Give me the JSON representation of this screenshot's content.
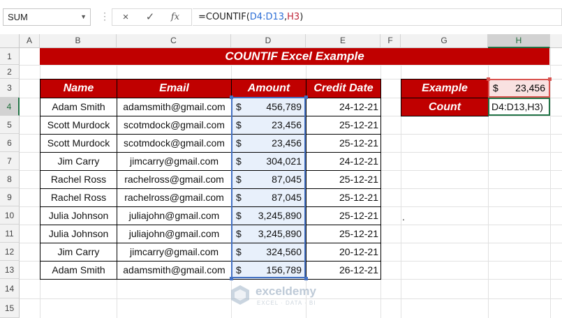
{
  "formula_bar": {
    "name_box": "SUM",
    "cancel_icon": "×",
    "enter_icon": "✓",
    "fx_icon": "fx",
    "formula_prefix": "=COUNTIF(",
    "formula_ref1": "D4:D13",
    "formula_comma": ",",
    "formula_ref2": "H3",
    "formula_suffix": ")"
  },
  "columns": [
    "A",
    "B",
    "C",
    "D",
    "E",
    "F",
    "G",
    "H"
  ],
  "rows": [
    "1",
    "2",
    "3",
    "4",
    "5",
    "6",
    "7",
    "8",
    "9",
    "10",
    "11",
    "12",
    "13",
    "14",
    "15"
  ],
  "title": "COUNTIF Excel Example",
  "table": {
    "headers": {
      "name": "Name",
      "email": "Email",
      "amount": "Amount",
      "date": "Credit Date"
    },
    "currency": "$",
    "rows": [
      {
        "name": "Adam Smith",
        "email": "adamsmith@gmail.com",
        "amount": "456,789",
        "date": "24-12-21"
      },
      {
        "name": "Scott Murdock",
        "email": "scotmdock@gmail.com",
        "amount": "23,456",
        "date": "25-12-21"
      },
      {
        "name": "Scott Murdock",
        "email": "scotmdock@gmail.com",
        "amount": "23,456",
        "date": "25-12-21"
      },
      {
        "name": "Jim Carry",
        "email": "jimcarry@gmail.com",
        "amount": "304,021",
        "date": "24-12-21"
      },
      {
        "name": "Rachel Ross",
        "email": "rachelross@gmail.com",
        "amount": "87,045",
        "date": "25-12-21"
      },
      {
        "name": "Rachel Ross",
        "email": "rachelross@gmail.com",
        "amount": "87,045",
        "date": "25-12-21"
      },
      {
        "name": "Julia Johnson",
        "email": "juliajohn@gmail.com",
        "amount": "3,245,890",
        "date": "25-12-21"
      },
      {
        "name": "Julia Johnson",
        "email": "juliajohn@gmail.com",
        "amount": "3,245,890",
        "date": "25-12-21"
      },
      {
        "name": "Jim Carry",
        "email": "jimcarry@gmail.com",
        "amount": "324,560",
        "date": "20-12-21"
      },
      {
        "name": "Adam Smith",
        "email": "adamsmith@gmail.com",
        "amount": "156,789",
        "date": "26-12-21"
      }
    ]
  },
  "side_table": {
    "example_label": "Example",
    "example_currency": "$",
    "example_value": "23,456",
    "count_label": "Count",
    "count_edit": "D4:D13,H3)"
  },
  "stray_mark": ".",
  "watermark": {
    "brand": "exceldemy",
    "tag": "EXCEL · DATA · BI"
  },
  "colors": {
    "header_red": "#c00000",
    "selection_blue": "#4472c4",
    "active_green": "#217346"
  }
}
